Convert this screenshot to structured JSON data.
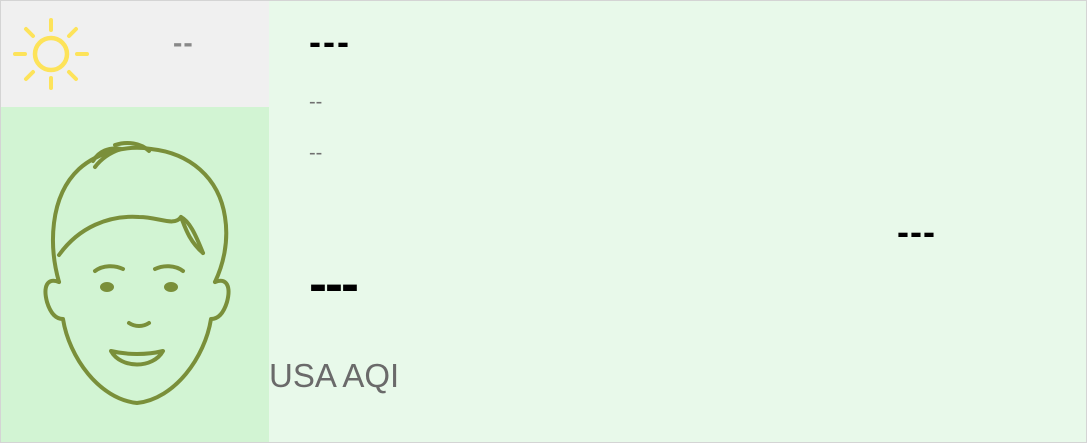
{
  "weather": {
    "icon": "sun-icon",
    "icon_color": "#fde35a",
    "temperature": "--"
  },
  "face": {
    "icon": "happy-face-icon",
    "color": "#7a8f3a",
    "panel_color": "#d2f4d3"
  },
  "main": {
    "location": "---",
    "line1": "--",
    "line2": "--",
    "pollutant": "---",
    "aqi_value": "---",
    "aqi_label": "USA AQI",
    "background": "#e8f9ea"
  }
}
